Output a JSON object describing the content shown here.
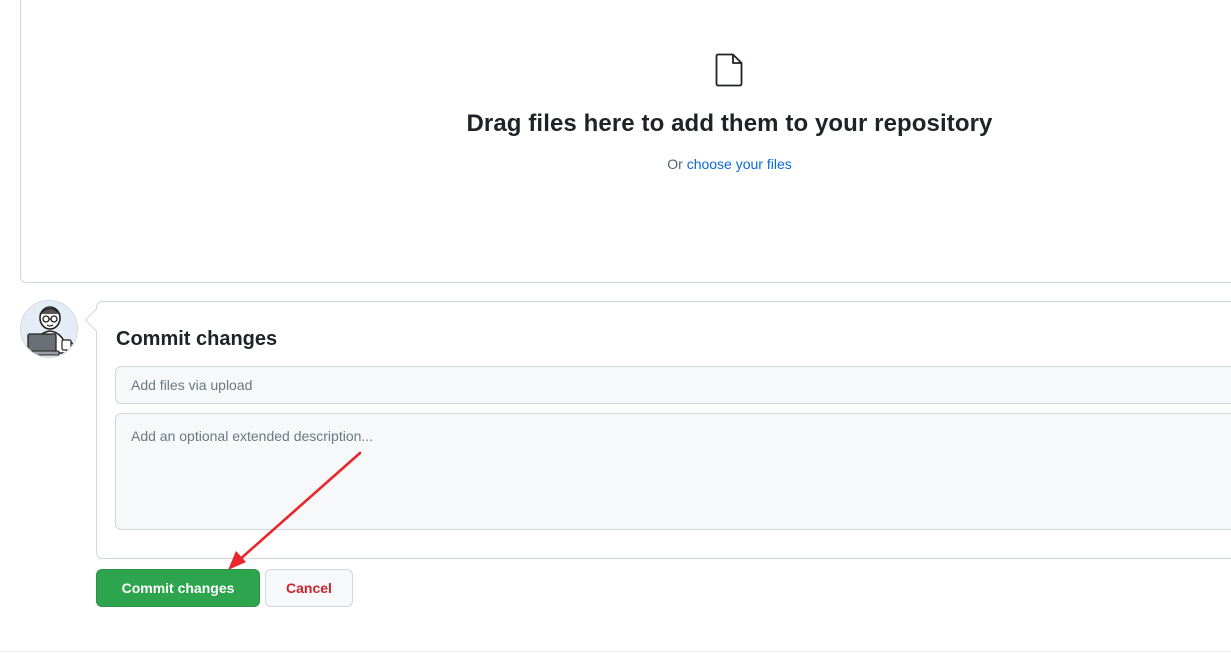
{
  "dropzone": {
    "icon": "file-icon",
    "title": "Drag files here to add them to your repository",
    "prefix": "Or ",
    "link_label": "choose your files"
  },
  "commit": {
    "avatar_icon": "user-avatar",
    "title": "Commit changes",
    "summary_placeholder": "Add files via upload",
    "description_placeholder": "Add an optional extended description..."
  },
  "buttons": {
    "commit_label": "Commit changes",
    "cancel_label": "Cancel"
  },
  "colors": {
    "commit_green": "#2da44e",
    "cancel_red": "#cf222e",
    "link_blue": "#0969da",
    "annotation_red": "#e8262b"
  }
}
